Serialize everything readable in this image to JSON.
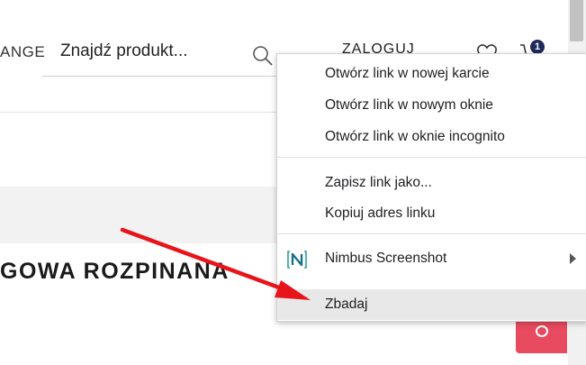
{
  "header": {
    "nav_partial": "ANGE",
    "search_value": "Znajdź produkt...",
    "login_label": "ZALOGUJ",
    "cart_count": "1"
  },
  "product": {
    "title": "GOWA ROZPINANA"
  },
  "context_menu": {
    "items": [
      {
        "label": "Otwórz link w nowej karcie"
      },
      {
        "label": "Otwórz link w nowym oknie"
      },
      {
        "label": "Otwórz link w oknie incognito"
      },
      {
        "label": "Zapisz link jako..."
      },
      {
        "label": "Kopiuj adres linku"
      },
      {
        "label": "Nimbus Screenshot",
        "icon": "nimbus-icon",
        "submenu": true
      },
      {
        "label": "Zbadaj",
        "highlighted": true
      }
    ]
  },
  "colors": {
    "annotation_arrow": "#e8141c",
    "accent_button": "#e84a5f",
    "cart_badge": "#1e2a5a",
    "menu_highlight": "#e8e8e8"
  }
}
